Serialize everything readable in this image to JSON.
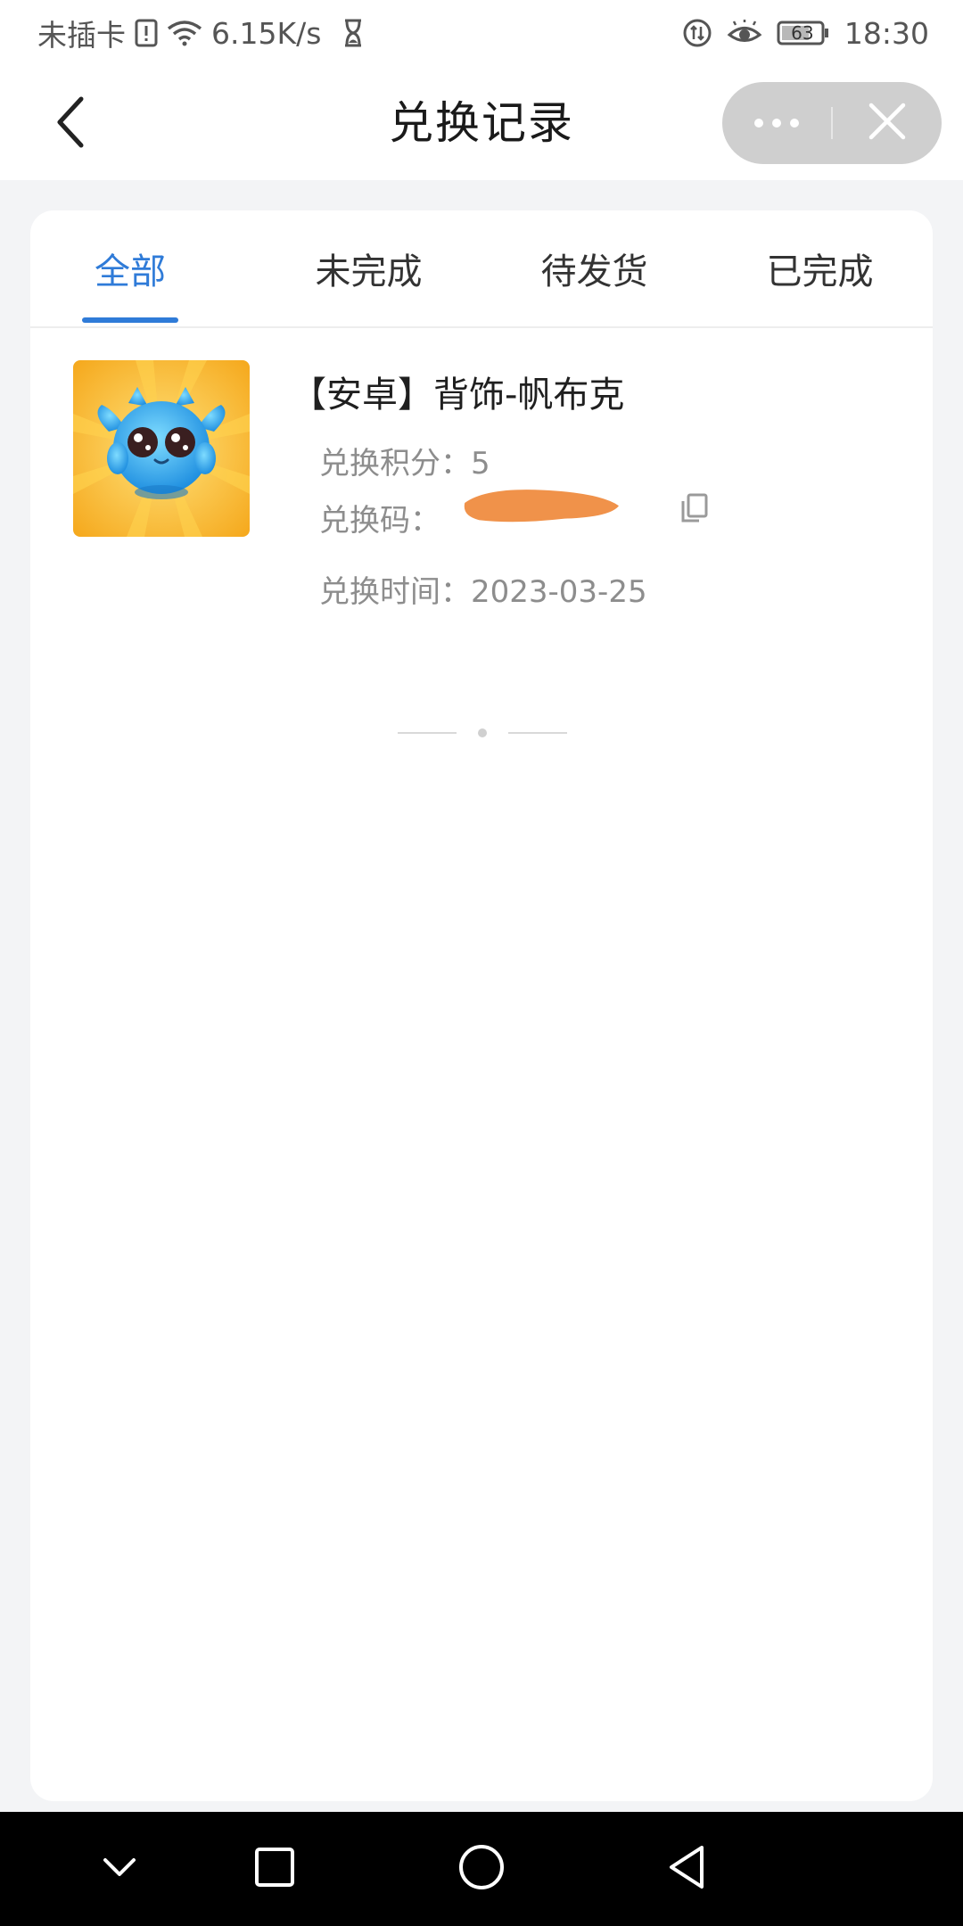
{
  "status_bar": {
    "carrier": "未插卡",
    "net_speed": "6.15K/s",
    "battery": "63",
    "time": "18:30"
  },
  "header": {
    "title": "兑换记录",
    "back_icon": "back-arrow-icon",
    "more_icon": "more-dots-icon",
    "close_icon": "close-icon"
  },
  "tabs": [
    {
      "label": "全部",
      "active": true
    },
    {
      "label": "未完成",
      "active": false
    },
    {
      "label": "待发货",
      "active": false
    },
    {
      "label": "已完成",
      "active": false
    }
  ],
  "records": [
    {
      "title": "【安卓】背饰-帆布克",
      "points_label": "兑换积分：",
      "points": "5",
      "code_label": "兑换码：",
      "time_label": "兑换时间：",
      "date": "2023-03-25"
    }
  ],
  "colors": {
    "accent": "#2f7bd8",
    "redaction": "#f0924a",
    "page_bg": "#f3f4f6"
  },
  "system_nav": [
    "chevron-down-icon",
    "square-icon",
    "circle-home-icon",
    "triangle-back-icon"
  ]
}
